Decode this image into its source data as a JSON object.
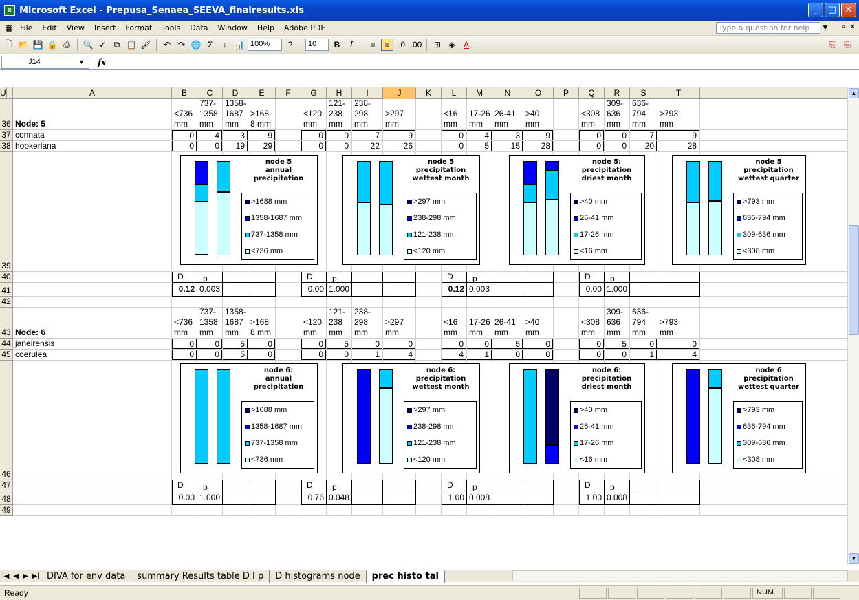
{
  "window": {
    "title": "Microsoft Excel - Prepusa_Senaea_SEEVA_finalresults.xls"
  },
  "menu": {
    "items": [
      "File",
      "Edit",
      "View",
      "Insert",
      "Format",
      "Tools",
      "Data",
      "Window",
      "Help",
      "Adobe PDF"
    ],
    "help_placeholder": "Type a question for help"
  },
  "toolbar": {
    "zoom": "100%",
    "font_size": "10"
  },
  "formula": {
    "namebox": "J14",
    "fx": "fx",
    "value": ""
  },
  "colors": {
    "c1": "#000066",
    "c2": "#0000ff",
    "c3": "#00ccff",
    "c4": "#ccffff"
  },
  "columns": [
    "A",
    "B",
    "C",
    "D",
    "E",
    "F",
    "G",
    "H",
    "I",
    "J",
    "K",
    "L",
    "M",
    "N",
    "O",
    "P",
    "Q",
    "R",
    "S",
    "T",
    "U"
  ],
  "rows": [
    "36",
    "37",
    "38",
    "39",
    "40",
    "41",
    "42",
    "43",
    "44",
    "45",
    "46",
    "47",
    "48",
    "49"
  ],
  "sections": [
    {
      "node_label": "Node: 5",
      "headers": {
        "B": "<736\nmm",
        "C": "737-\n1358\nmm",
        "D": "1358-\n1687\nmm",
        "E": ">168\n8 mm",
        "G": "<120\nmm",
        "H": "121-\n238\nmm",
        "I": "238-\n298\nmm",
        "J": ">297\nmm",
        "L": "<16\nmm",
        "M": "17-26\nmm",
        "N": "26-41\nmm",
        "O": ">40\nmm",
        "Q": "<308\nmm",
        "R": "309-\n636\nmm",
        "S": "636-\n794\nmm",
        "T": ">793\nmm"
      },
      "taxa": [
        {
          "name": "connata",
          "values": [
            "0",
            "4",
            "3",
            "9",
            "0",
            "0",
            "7",
            "9",
            "0",
            "4",
            "3",
            "9",
            "0",
            "0",
            "7",
            "9"
          ]
        },
        {
          "name": "hookeriana",
          "values": [
            "0",
            "0",
            "19",
            "29",
            "0",
            "0",
            "22",
            "26",
            "0",
            "5",
            "15",
            "28",
            "0",
            "0",
            "20",
            "28"
          ]
        }
      ],
      "stats_labels": [
        "D",
        "p"
      ],
      "stats": [
        {
          "D": "0.12",
          "p": "0.003",
          "bold": true
        },
        {
          "D": "0.00",
          "p": "1.000",
          "bold": false
        },
        {
          "D": "0.12",
          "p": "0.003",
          "bold": true
        },
        {
          "D": "0.00",
          "p": "1.000",
          "bold": false
        }
      ],
      "charts": [
        {
          "title": "node 5\nannual\nprecipitation",
          "legend": [
            ">1688 mm",
            "1358-1687 mm",
            "737-1358 mm",
            "<736 mm"
          ],
          "bars": [
            [
              0,
              25,
              18,
              56
            ],
            [
              0,
              0,
              33,
              67
            ]
          ]
        },
        {
          "title": "node 5\nprecipitation\nwettest month",
          "legend": [
            ">297 mm",
            "238-298 mm",
            "121-238 mm",
            "<120 mm"
          ],
          "bars": [
            [
              0,
              0,
              44,
              56
            ],
            [
              0,
              0,
              46,
              54
            ]
          ]
        },
        {
          "title": "node 5:\nprecipitation\ndriest month",
          "legend": [
            ">40 mm",
            "26-41 mm",
            "17-26 mm",
            "<16 mm"
          ],
          "bars": [
            [
              0,
              25,
              19,
              56
            ],
            [
              0,
              10,
              31,
              59
            ]
          ]
        },
        {
          "title": "node 5\nprecipitation\nwettest quarter",
          "legend": [
            ">793 mm",
            "636-794 mm",
            "309-636 mm",
            "<308 mm"
          ],
          "bars": [
            [
              0,
              0,
              44,
              56
            ],
            [
              0,
              0,
              42,
              58
            ]
          ]
        }
      ]
    },
    {
      "node_label": "Node: 6",
      "headers": {
        "B": "<736\nmm",
        "C": "737-\n1358\nmm",
        "D": "1358-\n1687\nmm",
        "E": ">168\n8 mm",
        "G": "<120\nmm",
        "H": "121-\n238\nmm",
        "I": "238-\n298\nmm",
        "J": ">297\nmm",
        "L": "<16\nmm",
        "M": "17-26\nmm",
        "N": "26-41\nmm",
        "O": ">40\nmm",
        "Q": "<308\nmm",
        "R": "309-\n636\nmm",
        "S": "636-\n794\nmm",
        "T": ">793\nmm"
      },
      "taxa": [
        {
          "name": "janeirensis",
          "values": [
            "0",
            "0",
            "5",
            "0",
            "0",
            "5",
            "0",
            "0",
            "0",
            "0",
            "5",
            "0",
            "0",
            "5",
            "0",
            "0"
          ]
        },
        {
          "name": "coerulea",
          "values": [
            "0",
            "0",
            "5",
            "0",
            "0",
            "0",
            "1",
            "4",
            "4",
            "1",
            "0",
            "0",
            "0",
            "0",
            "1",
            "4"
          ]
        }
      ],
      "stats_labels": [
        "D",
        "p"
      ],
      "stats": [
        {
          "D": "0.00",
          "p": "1.000",
          "bold": false
        },
        {
          "D": "0.76",
          "p": "0.048",
          "bold": false
        },
        {
          "D": "1.00",
          "p": "0.008",
          "bold": false
        },
        {
          "D": "1.00",
          "p": "0.008",
          "bold": false
        }
      ],
      "charts": [
        {
          "title": "node 6:\nannual\nprecipitation",
          "legend": [
            ">1688 mm",
            "1358-1687 mm",
            "737-1358 mm",
            "<736 mm"
          ],
          "bars": [
            [
              0,
              0,
              100,
              0
            ],
            [
              0,
              0,
              100,
              0
            ]
          ]
        },
        {
          "title": "node 6:\nprecipitation\nwettest month",
          "legend": [
            ">297 mm",
            "238-298 mm",
            "121-238 mm",
            "<120 mm"
          ],
          "bars": [
            [
              0,
              100,
              0,
              0
            ],
            [
              0,
              0,
              20,
              80
            ]
          ]
        },
        {
          "title": "node 6:\nprecipitation\ndriest month",
          "legend": [
            ">40 mm",
            "26-41 mm",
            "17-26 mm",
            "<16 mm"
          ],
          "bars": [
            [
              0,
              0,
              100,
              0
            ],
            [
              80,
              20,
              0,
              0
            ]
          ]
        },
        {
          "title": "node 6\nprecipitation\nwettest quarter",
          "legend": [
            ">793 mm",
            "636-794 mm",
            "309-636 mm",
            "<308 mm"
          ],
          "bars": [
            [
              0,
              100,
              0,
              0
            ],
            [
              0,
              0,
              20,
              80
            ]
          ]
        }
      ]
    }
  ],
  "sheets": {
    "tabs": [
      "DIVA for env data",
      "summary Results table D I p",
      "D histograms node",
      "prec histo tal"
    ],
    "active": 3
  },
  "status": {
    "text": "Ready",
    "num": "NUM"
  }
}
